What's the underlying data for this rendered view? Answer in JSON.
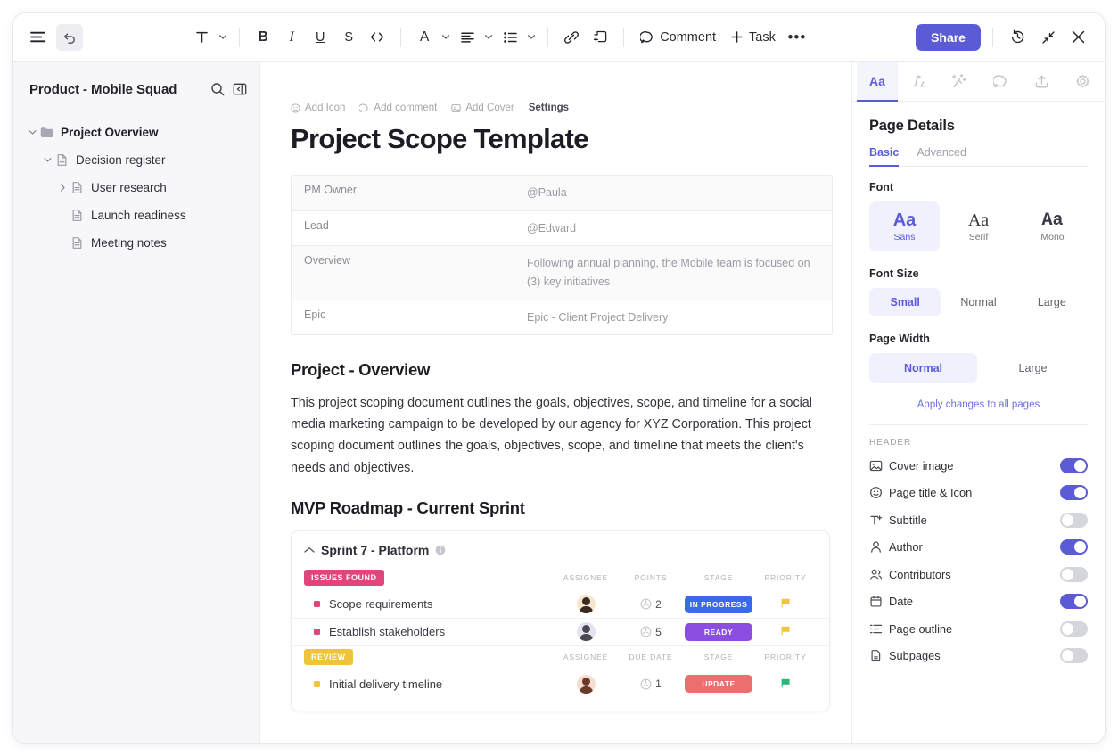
{
  "toolbar": {
    "menu_icon": "hamburger-menu-icon",
    "undo_icon": "undo-icon",
    "text_style_icon": "T",
    "bold_label": "B",
    "italic_label": "I",
    "underline_label": "U",
    "strikethrough_label": "S",
    "code_icon": "code-icon",
    "font_color_label": "A",
    "align_icon": "align-left-icon",
    "list_icon": "bullet-list-icon",
    "link_icon": "link-icon",
    "attach_icon": "attachment-icon",
    "comment_label": "Comment",
    "task_label": "Task",
    "more_label": "•••",
    "share_label": "Share",
    "history_icon": "history-clock-icon",
    "collapse_icon": "collapse-arrows-icon",
    "close_icon": "close-x-icon"
  },
  "sidebar": {
    "title": "Product - Mobile Squad",
    "search_icon": "search-icon",
    "panel_icon": "collapse-panel-icon",
    "items": [
      {
        "label": "Project Overview",
        "depth": 0,
        "arrow": "down",
        "icon": "folder-icon",
        "bold": true
      },
      {
        "label": "Decision register",
        "depth": 1,
        "arrow": "down",
        "icon": "doc-icon",
        "bold": false
      },
      {
        "label": "User research",
        "depth": 2,
        "arrow": "right",
        "icon": "doc-icon",
        "bold": false
      },
      {
        "label": "Launch readiness",
        "depth": 2,
        "arrow": "none",
        "icon": "doc-icon",
        "bold": false
      },
      {
        "label": "Meeting notes",
        "depth": 2,
        "arrow": "none",
        "icon": "doc-icon",
        "bold": false
      }
    ]
  },
  "doc": {
    "actions": [
      {
        "label": "Add Icon",
        "icon": "smiley-icon"
      },
      {
        "label": "Add comment",
        "icon": "comment-icon"
      },
      {
        "label": "Add Cover",
        "icon": "image-icon"
      },
      {
        "label": "Settings",
        "icon": "none"
      }
    ],
    "title": "Project Scope Template",
    "meta_rows": [
      {
        "key": "PM Owner",
        "value": "@Paula"
      },
      {
        "key": "Lead",
        "value": "@Edward"
      },
      {
        "key": "Overview",
        "value": "Following annual planning, the Mobile team is focused on (3) key initiatives"
      },
      {
        "key": "Epic",
        "value": "Epic - Client Project Delivery"
      }
    ],
    "section1_heading": "Project - Overview",
    "section1_body": "This project scoping document outlines the goals, objectives, scope, and timeline for a social media marketing campaign to be developed by our agency for XYZ Corporation. This project scoping document outlines the goals, objectives, scope, and timeline that meets the client's needs and objectives.",
    "section2_heading": "MVP Roadmap - Current Sprint",
    "sprint": {
      "collapse_icon": "chevron-up-icon",
      "name": "Sprint  7 - Platform",
      "info_icon": "info-icon",
      "groups": [
        {
          "tag": "ISSUES FOUND",
          "tag_color": "#e0457b",
          "columns": [
            "ASSIGNEE",
            "POINTS",
            "STAGE",
            "PRIORITY"
          ],
          "tasks": [
            {
              "name": "Scope requirements",
              "dot_color": "#e0457b",
              "points": "2",
              "stage": "IN PROGRESS",
              "stage_color": "#3b6ae8",
              "priority_flag": "#f5c33b",
              "avatar_bg": "#f7e6cf",
              "avatar_hair": "#3a2a22"
            },
            {
              "name": "Establish stakeholders",
              "dot_color": "#e0457b",
              "points": "5",
              "stage": "READY",
              "stage_color": "#8b4ee0",
              "priority_flag": "#f5c33b",
              "avatar_bg": "#e6e2ef",
              "avatar_hair": "#4a4a52"
            }
          ]
        },
        {
          "tag": "REVIEW",
          "tag_color": "#f0c33c",
          "columns": [
            "ASSIGNEE",
            "DUE DATE",
            "STAGE",
            "PRIORITY"
          ],
          "tasks": [
            {
              "name": "Initial delivery timeline",
              "dot_color": "#f0c33c",
              "points": "1",
              "stage": "UPDATE",
              "stage_color": "#ec6e6e",
              "priority_flag": "#2fb57c",
              "avatar_bg": "#f6ddd2",
              "avatar_hair": "#6b3a2c"
            }
          ]
        }
      ]
    }
  },
  "right_panel": {
    "tabs": [
      {
        "icon": "Aa",
        "name": "text-format-tab",
        "active": true
      },
      {
        "icon": "relationship-icon",
        "name": "relationships-tab",
        "active": false
      },
      {
        "icon": "ai-wand-icon",
        "name": "ai-tab",
        "active": false
      },
      {
        "icon": "comment-icon",
        "name": "comments-tab",
        "active": false
      },
      {
        "icon": "share-upload-icon",
        "name": "share-tab",
        "active": false
      },
      {
        "icon": "gear-icon",
        "name": "settings-tab",
        "active": false
      }
    ],
    "title": "Page Details",
    "subtabs": [
      {
        "label": "Basic",
        "active": true
      },
      {
        "label": "Advanced",
        "active": false
      }
    ],
    "font_label": "Font",
    "font_options": [
      {
        "sample": "Aa",
        "label": "Sans",
        "selected": true
      },
      {
        "sample": "Aa",
        "label": "Serif",
        "selected": false
      },
      {
        "sample": "Aa",
        "label": "Mono",
        "selected": false
      }
    ],
    "font_size_label": "Font Size",
    "font_sizes": [
      {
        "label": "Small",
        "selected": true
      },
      {
        "label": "Normal",
        "selected": false
      },
      {
        "label": "Large",
        "selected": false
      }
    ],
    "page_width_label": "Page Width",
    "page_widths": [
      {
        "label": "Normal",
        "selected": true
      },
      {
        "label": "Large",
        "selected": false
      }
    ],
    "apply_link": "Apply changes to all pages",
    "header_section_label": "HEADER",
    "header_toggles": [
      {
        "label": "Cover image",
        "icon": "image-icon",
        "on": true
      },
      {
        "label": "Page title & Icon",
        "icon": "smiley-icon",
        "on": true
      },
      {
        "label": "Subtitle",
        "icon": "text-plus-icon",
        "on": false
      },
      {
        "label": "Author",
        "icon": "person-icon",
        "on": true
      },
      {
        "label": "Contributors",
        "icon": "people-icon",
        "on": false
      },
      {
        "label": "Date",
        "icon": "calendar-icon",
        "on": true
      },
      {
        "label": "Page outline",
        "icon": "outline-list-icon",
        "on": false
      },
      {
        "label": "Subpages",
        "icon": "subpages-icon",
        "on": false
      }
    ]
  },
  "colors": {
    "accent": "#5b5bd6",
    "accent_soft": "#f1f0fd",
    "sidebar_bg": "#f7f7fa"
  }
}
